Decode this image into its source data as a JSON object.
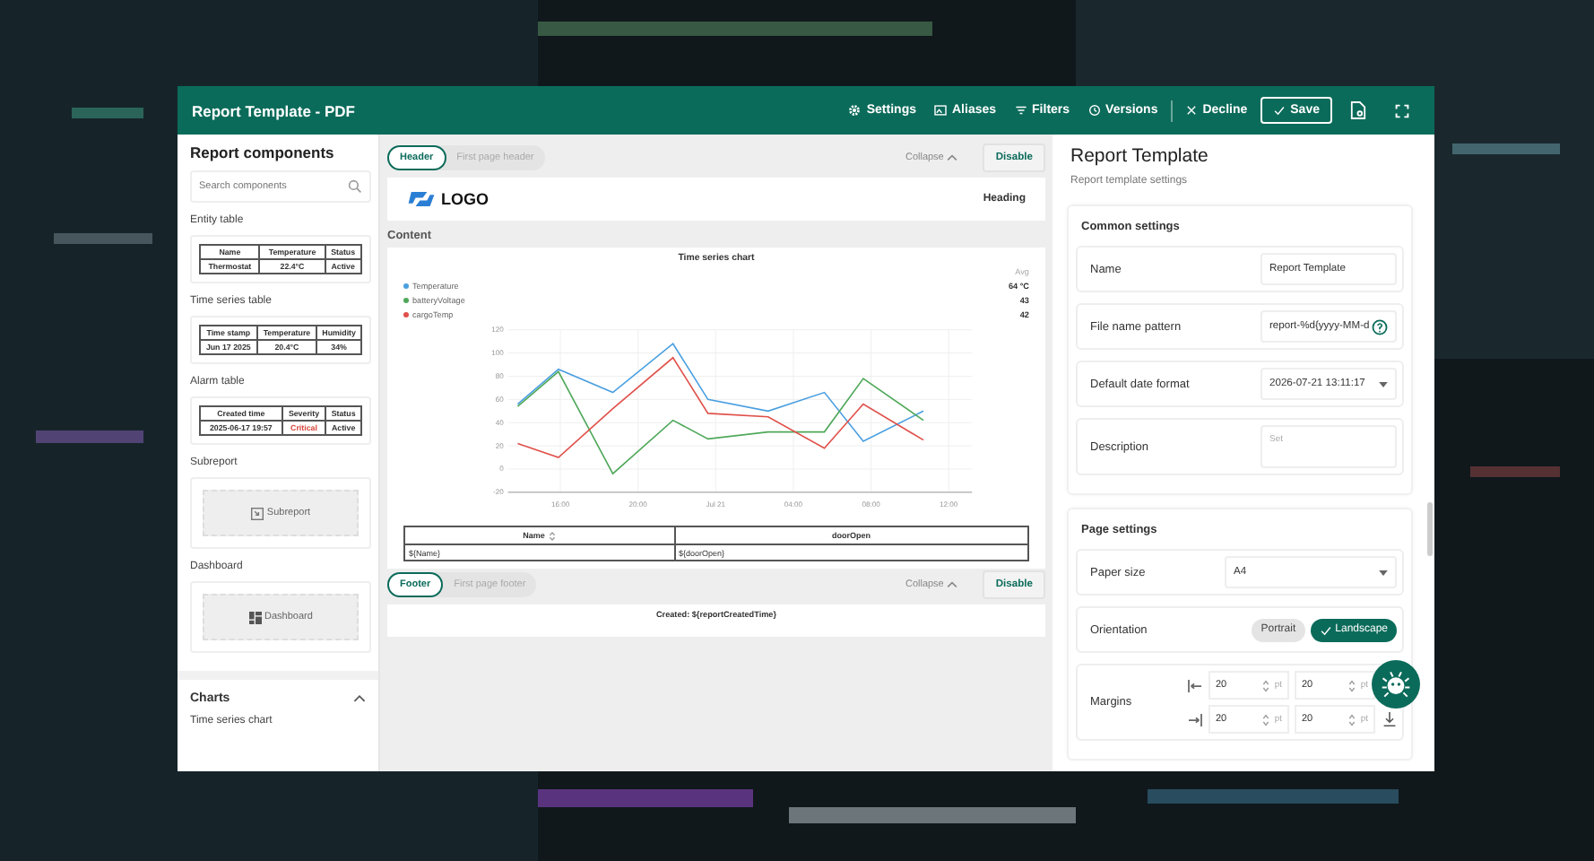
{
  "window": {
    "title": "Report Template - PDF"
  },
  "toolbar": [
    {
      "label": "Settings",
      "kind": "gear"
    },
    {
      "label": "Aliases",
      "kind": "alias"
    },
    {
      "label": "Filters",
      "kind": "filter"
    },
    {
      "label": "Versions",
      "kind": "history"
    },
    {
      "label": "Decline",
      "kind": "close"
    },
    {
      "label": "Save",
      "kind": "save"
    }
  ],
  "sidebar": {
    "title": "Report components",
    "search": {
      "placeholder": "Search components"
    },
    "components": [
      {
        "label": "Entity table",
        "kind": "table",
        "columns": [
          "Name",
          "Temperature",
          "Status"
        ],
        "row": [
          {
            "text": "Thermostat"
          },
          {
            "text": "22.4°C"
          },
          {
            "text": "Active"
          }
        ]
      },
      {
        "label": "Time series table",
        "kind": "table",
        "columns": [
          "Time stamp",
          "Temperature",
          "Humidity"
        ],
        "row": [
          {
            "text": "Jun 17 2025"
          },
          {
            "text": "20.4°C"
          },
          {
            "text": "34%"
          }
        ]
      },
      {
        "label": "Alarm table",
        "kind": "table",
        "columns": [
          "Created time",
          "Severity",
          "Status"
        ],
        "row": [
          {
            "text": "2025-06-17 19:57"
          },
          {
            "text": "Critical",
            "color": "#d9463c"
          },
          {
            "text": "Active"
          }
        ]
      },
      {
        "label": "Subreport",
        "kind": "subreport",
        "text": "Subreport"
      },
      {
        "label": "Dashboard",
        "kind": "dashboard",
        "text": "Dashboard"
      }
    ],
    "charts": {
      "title": "Charts",
      "expanded": true,
      "items": [
        "Time series chart"
      ]
    }
  },
  "header": {
    "tabs": [
      {
        "label": "Header",
        "selected": true
      },
      {
        "label": "First page header",
        "selected": false
      }
    ],
    "collapse": "Collapse",
    "disable": "Disable",
    "logo": "LOGO",
    "heading": "Heading"
  },
  "content": {
    "title": "Content",
    "chart": {
      "title": "Time series chart",
      "avg_label": "Avg",
      "legend": [
        {
          "avg": "64 °C"
        },
        {
          "avg": "43"
        },
        {
          "avg": "42"
        }
      ],
      "chart_data": {
        "type": "line",
        "grid": true,
        "x": [
          "2026-07-20T13:48",
          "2026-07-20T15:54",
          "2026-07-20T18:42",
          "2026-07-20T21:48",
          "2026-07-20T23:36",
          "2026-07-21T02:42",
          "2026-07-21T05:36",
          "2026-07-21T07:36",
          "2026-07-21T10:42"
        ],
        "series": [
          {
            "name": "Temperature",
            "color": "#4a9fe0",
            "values": [
              56,
              86,
              66,
              108,
              60,
              50,
              66,
              24,
              50
            ]
          },
          {
            "name": "batteryVoltage",
            "color": "#4fa85a",
            "values": [
              54,
              84,
              -4,
              42,
              26,
              32,
              32,
              78,
              42
            ]
          },
          {
            "name": "cargoTemp",
            "color": "#e0504a",
            "values": [
              22,
              10,
              52,
              96,
              48,
              45,
              18,
              56,
              25
            ]
          }
        ],
        "xlim": [
          "2026-07-20T13:18",
          "2026-07-21T13:12"
        ],
        "ylim": [
          -20,
          120
        ],
        "xticks": [
          {
            "value": "2026-07-20T16:00",
            "label": "16:00"
          },
          {
            "value": "2026-07-20T20:00",
            "label": "20:00"
          },
          {
            "value": "2026-07-21T00:00",
            "label": "Jul 21"
          },
          {
            "value": "2026-07-21T04:00",
            "label": "04:00"
          },
          {
            "value": "2026-07-21T08:00",
            "label": "08:00"
          },
          {
            "value": "2026-07-21T12:00",
            "label": "12:00"
          }
        ],
        "yticks": [
          -20,
          0,
          20,
          40,
          60,
          80,
          100,
          120
        ]
      }
    },
    "table": {
      "columns": [
        "Name",
        "doorOpen"
      ],
      "row": [
        "${Name}",
        "${doorOpen}"
      ]
    }
  },
  "footer": {
    "tabs": [
      {
        "label": "Footer",
        "selected": true
      },
      {
        "label": "First page footer",
        "selected": false
      }
    ],
    "collapse": "Collapse",
    "disable": "Disable",
    "text": "Created: ${reportCreatedTime}"
  },
  "settings": {
    "title": "Report Template",
    "subtitle": "Report template settings",
    "sections": [
      {
        "title": "Common settings",
        "fields": [
          {
            "kind": "input",
            "label": "Name",
            "value": "Report Template"
          },
          {
            "kind": "help",
            "label": "File name pattern",
            "value": "report-%d{yyyy-MM-d"
          },
          {
            "kind": "select",
            "label": "Default date format",
            "value": "2026-07-21 13:11:17"
          },
          {
            "kind": "textarea",
            "label": "Description",
            "placeholder": "Set"
          }
        ]
      },
      {
        "title": "Page settings",
        "fields": [
          {
            "kind": "select",
            "label": "Paper size",
            "value": "A4"
          },
          {
            "kind": "toggle",
            "label": "Orientation",
            "options": [
              {
                "label": "Portrait",
                "selected": false
              },
              {
                "label": "Landscape",
                "selected": true
              }
            ]
          },
          {
            "kind": "margins",
            "label": "Margins",
            "values": [
              "20",
              "20",
              "20",
              "20"
            ],
            "units": [
              "pt",
              "pt",
              "pt",
              "pt"
            ]
          }
        ]
      }
    ]
  }
}
